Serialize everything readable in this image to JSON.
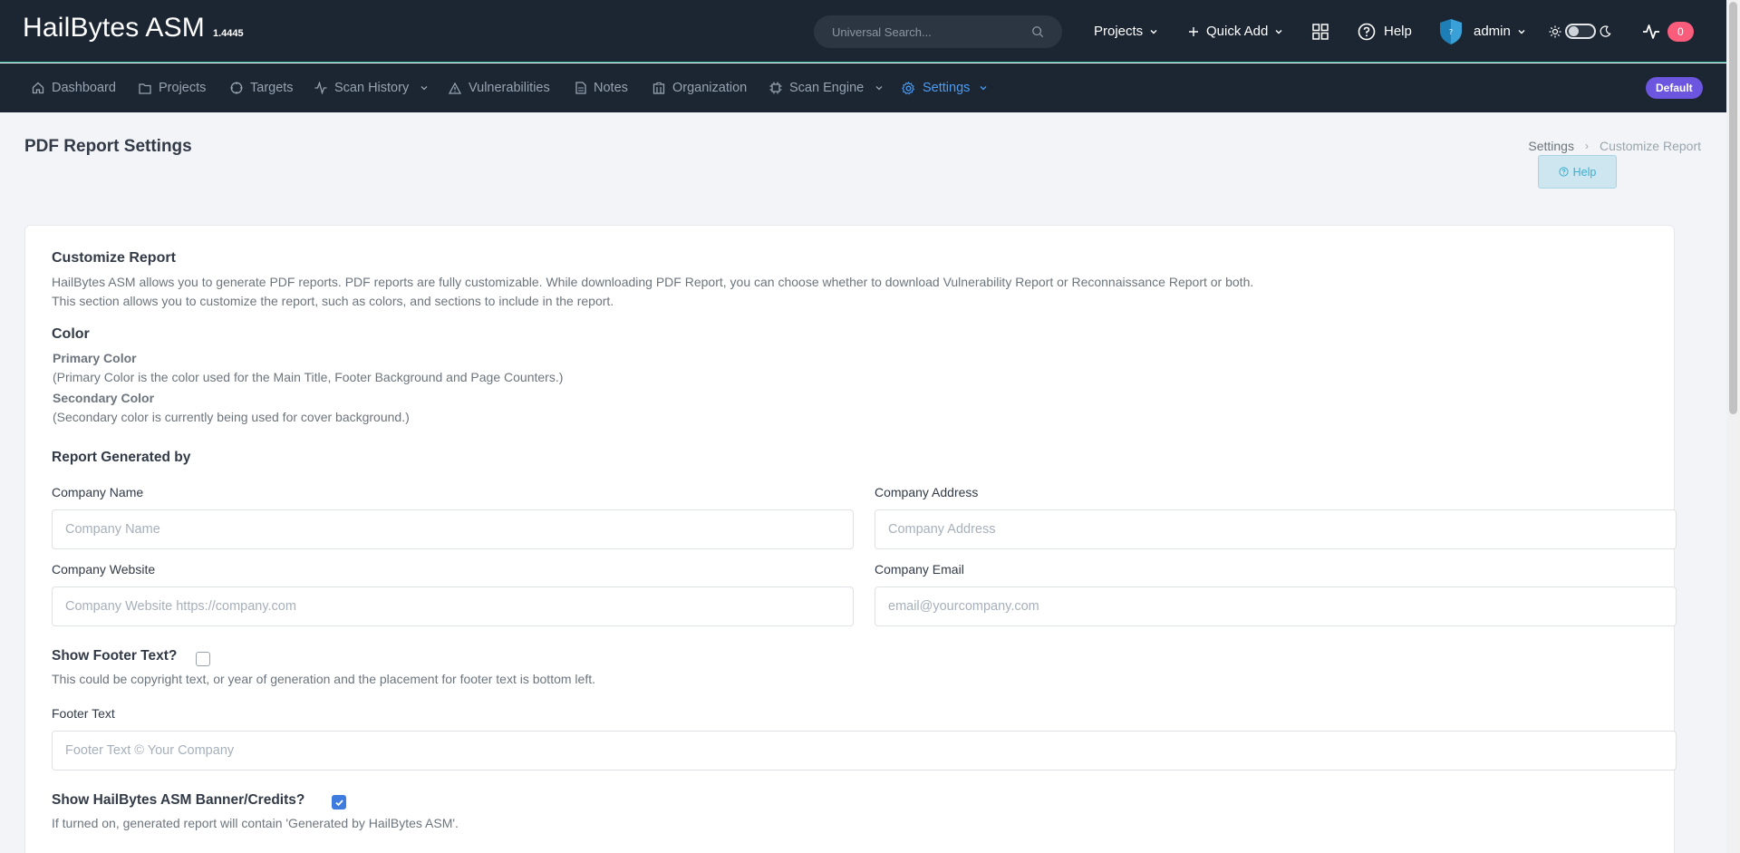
{
  "header": {
    "brand": "HailBytes ASM",
    "version": "1.4445",
    "search_placeholder": "Universal Search...",
    "projects_label": "Projects",
    "quick_add_label": "Quick Add",
    "help_label": "Help",
    "user_label": "admin",
    "notifications_count": "0"
  },
  "nav": {
    "items": [
      {
        "label": "Dashboard"
      },
      {
        "label": "Projects"
      },
      {
        "label": "Targets"
      },
      {
        "label": "Scan History"
      },
      {
        "label": "Vulnerabilities"
      },
      {
        "label": "Notes"
      },
      {
        "label": "Organization"
      },
      {
        "label": "Scan Engine"
      },
      {
        "label": "Settings"
      }
    ],
    "project_badge": "Default"
  },
  "page": {
    "title": "PDF Report Settings",
    "breadcrumb": {
      "parent": "Settings",
      "current": "Customize Report"
    },
    "help_button": "Help"
  },
  "content": {
    "customize_heading": "Customize Report",
    "customize_desc_1": "HailBytes ASM allows you to generate PDF reports. PDF reports are fully customizable. While downloading PDF Report, you can choose whether to download Vulnerability Report or Reconnaissance Report or both.",
    "customize_desc_2": "This section allows you to customize the report, such as colors, and sections to include in the report.",
    "color_heading": "Color",
    "primary_color_label": "Primary Color",
    "primary_color_desc": "(Primary Color is the color used for the Main Title, Footer Background and Page Counters.)",
    "secondary_color_label": "Secondary Color",
    "secondary_color_desc": "(Secondary color is currently being used for cover background.)",
    "generated_by_heading": "Report Generated by",
    "company_name_label": "Company Name",
    "company_name_placeholder": "Company Name",
    "company_address_label": "Company Address",
    "company_address_placeholder": "Company Address",
    "company_website_label": "Company Website",
    "company_website_placeholder": "Company Website https://company.com",
    "company_email_label": "Company Email",
    "company_email_placeholder": "email@yourcompany.com",
    "show_footer_label": "Show Footer Text?",
    "show_footer_checked": false,
    "show_footer_desc": "This could be copyright text, or year of generation and the placement for footer text is bottom left.",
    "footer_text_label": "Footer Text",
    "footer_text_placeholder": "Footer Text © Your Company",
    "show_banner_label": "Show HailBytes ASM Banner/Credits?",
    "show_banner_checked": true,
    "show_banner_desc": "If turned on, generated report will contain 'Generated by HailBytes ASM'."
  },
  "colors": {
    "header_bg": "#1c2632",
    "accent_teal": "#29a996",
    "active_nav": "#4a9cf5",
    "badge_purple": "#6c56e0",
    "badge_red": "#fa5c7c",
    "checkbox_blue": "#3e7bdf"
  }
}
